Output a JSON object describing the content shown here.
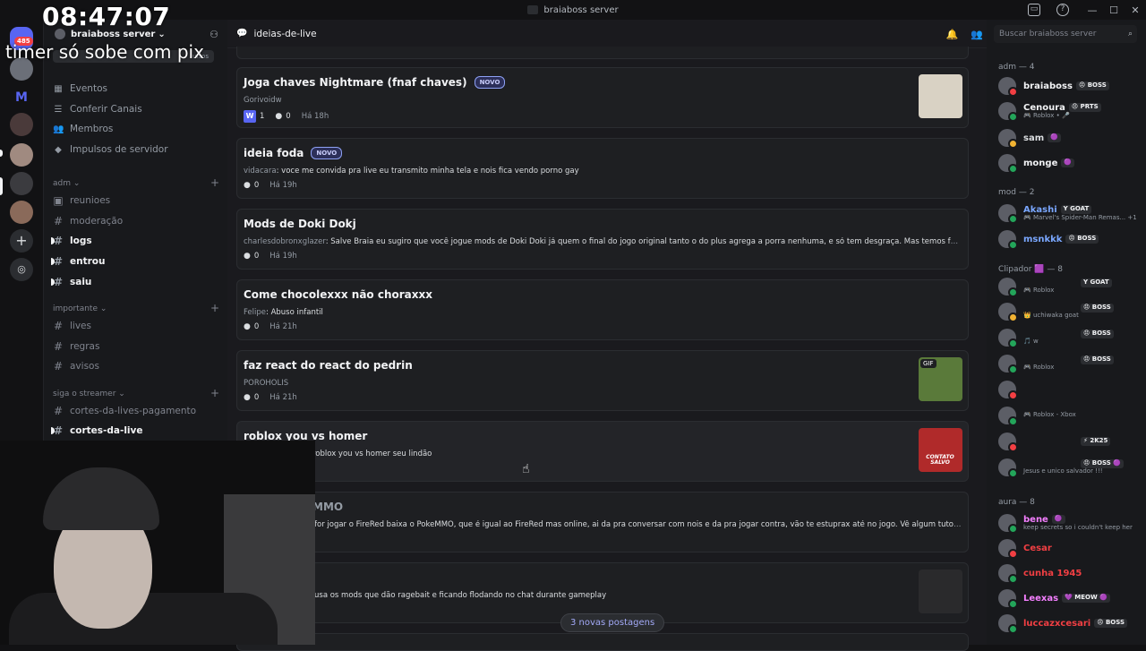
{
  "window": {
    "title": "braiaboss server",
    "controls": [
      "—",
      "☐",
      "✕"
    ]
  },
  "overlay": {
    "time": "08:47:07",
    "text": "timer só sobe com pix"
  },
  "guilds": {
    "mention_badge": "485"
  },
  "sidebar": {
    "server_name": "braiaboss server",
    "boost_text": "ulsos",
    "menu": [
      {
        "label": "Eventos",
        "icon": "calendar-icon"
      },
      {
        "label": "Conferir Canais",
        "icon": "browse-channels-icon"
      },
      {
        "label": "Membros",
        "icon": "members-icon"
      },
      {
        "label": "Impulsos de servidor",
        "icon": "boost-icon"
      }
    ],
    "categories": {
      "adm": "adm",
      "importante": "importante",
      "siga": "siga o streamer"
    },
    "channels": {
      "reunioes": "reunioes",
      "moderacao": "moderação",
      "logs": "logs",
      "entrou": "entrou",
      "saiu": "saiu",
      "lives": "lives",
      "regras": "regras",
      "avisos": "avisos",
      "cortes_pag": "cortes-da-lives-pagamento",
      "cortes_live": "cortes-da-live"
    }
  },
  "channel_header": {
    "name": "ideias-de-live"
  },
  "posts": [
    {
      "title": "Joga chaves Nightmare (fnaf chaves)",
      "novo": "NOVO",
      "author": "Gorivoidw",
      "message": "",
      "reaction_count": "1",
      "replies": "0",
      "time": "Há 18h",
      "thumb_color": "#d9d2c4"
    },
    {
      "title": "ideia foda",
      "novo": "NOVO",
      "author": "vidacara",
      "message": ": voce me convida pra live eu transmito minha tela e nois fica vendo porno gay",
      "replies": "0",
      "time": "Há 19h"
    },
    {
      "title": "Mods de Doki Dokj",
      "author": "charlesdobronxglazer",
      "message": ": Salve Braia eu sugiro que você jogue mods de Doki Doki já quem o final do jogo original tanto o do plus agrega a porra nenhuma, e só tem desgraça. Mas temos feliz os mods, var...",
      "replies": "0",
      "time": "Há 19h"
    },
    {
      "title": "Come chocolexxx não choraxxx",
      "author": "Felipe",
      "message": ": Abuso infantil",
      "replies": "0",
      "time": "Há 21h"
    },
    {
      "title": "faz react do react do pedrin",
      "author": "POROHOLIS",
      "message": "",
      "replies": "0",
      "time": "Há 21h",
      "thumb_label": "GIF"
    },
    {
      "title": "roblox you vs homer",
      "author": "",
      "message": "roblox you vs homer seu lindão",
      "replies": "",
      "time": "",
      "thumb_label": "CONTATO SALVO"
    },
    {
      "title": "MMO",
      "author": "",
      "message": "for jogar o FireRed baixa o PokeMMO, que é igual ao FireRed mas online, ai da pra conversar com nois e da pra jogar contra, vão te estuprax até no jogo. Vê algum tutorial pra baixar...",
      "replies": "",
      "time": ""
    },
    {
      "title": "",
      "author": "",
      "message": "usa os mods que dão ragebait e ficando flodando no chat durante gameplay",
      "replies": "",
      "time": ""
    }
  ],
  "new_posts_button": "3 novas postagens",
  "members": {
    "search_placeholder": "Buscar braiaboss server",
    "groups": [
      {
        "label": "adm — 4"
      },
      {
        "label": "mod — 2"
      },
      {
        "label": "Clipador 🟪 — 8"
      },
      {
        "label": "aura — 8"
      }
    ],
    "list": [
      {
        "name": "braiaboss",
        "tag": "😠 BOSS",
        "activity": "",
        "color": "#f2f3f5",
        "status": "#f23f43"
      },
      {
        "name": "Cenoura",
        "tag": "😠 PRTS",
        "activity": "🎮 Roblox • 🎤",
        "color": "#f2f3f5",
        "status": "#23a55a"
      },
      {
        "name": "sam",
        "tag": "🟣",
        "activity": "",
        "color": "#dbdee1",
        "status": "#f0b232"
      },
      {
        "name": "monge",
        "tag": "🟣",
        "activity": "",
        "color": "#f2f3f5",
        "status": "#23a55a"
      },
      {
        "name": "Akashi",
        "tag": "Y GOAT",
        "activity": "🎮 Marvel's Spider-Man Remas... +1",
        "color": "#7aa7ff",
        "status": "#23a55a"
      },
      {
        "name": "msnkkk",
        "tag": "😠 BOSS",
        "activity": "",
        "color": "#7aa7ff",
        "status": "#23a55a"
      },
      {
        "name": "",
        "tag": "Y GOAT",
        "activity": "🎮 Roblox",
        "color": "#dbdee1",
        "status": "#23a55a"
      },
      {
        "name": "",
        "tag": "😠 BOSS",
        "activity": "👑 uchiwaka goat",
        "color": "#dbdee1",
        "status": "#f0b232"
      },
      {
        "name": "",
        "tag": "😠 BOSS",
        "activity": "🎵 w",
        "color": "#dbdee1",
        "status": "#23a55a"
      },
      {
        "name": "",
        "tag": "😠 BOSS",
        "activity": "🎮 Roblox",
        "color": "#dbdee1",
        "status": "#23a55a"
      },
      {
        "name": "",
        "tag": "",
        "activity": "",
        "color": "#dbdee1",
        "status": "#f23f43"
      },
      {
        "name": "",
        "tag": "",
        "activity": "🎮 Roblox - Xbox",
        "color": "#dbdee1",
        "status": "#23a55a"
      },
      {
        "name": "",
        "tag": "⚡ 2K25",
        "activity": "",
        "color": "#dbdee1",
        "status": "#f23f43"
      },
      {
        "name": "",
        "tag": "😠 BOSS 🟣",
        "activity": "Jesus e unico salvador !!!",
        "color": "#dbdee1",
        "status": "#23a55a"
      },
      {
        "name": "bene",
        "tag": "🟣",
        "activity": "keep secrets so i couldn't keep her",
        "color": "#f47fff",
        "status": "#23a55a"
      },
      {
        "name": "Cesar",
        "tag": "",
        "activity": "",
        "color": "#f23f43",
        "status": "#f23f43"
      },
      {
        "name": "cunha 1945",
        "tag": "",
        "activity": "",
        "color": "#f23f43",
        "status": "#23a55a"
      },
      {
        "name": "Leexas",
        "tag": "💜 MEOW 🟣",
        "activity": "",
        "color": "#f47fff",
        "status": "#23a55a"
      },
      {
        "name": "luccazxcesari",
        "tag": "😠 BOSS",
        "activity": "",
        "color": "#f23f43",
        "status": "#23a55a"
      }
    ]
  },
  "colors": {
    "accent": "#5865f2",
    "bg": "#1a1a1e",
    "sidebar": "#18191c"
  }
}
